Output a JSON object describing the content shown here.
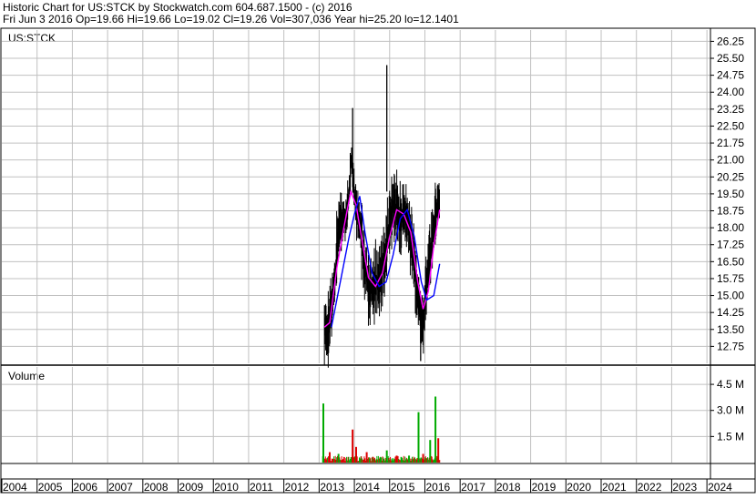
{
  "header": {
    "line1": "Historic Chart for US:STCK by Stockwatch.com 604.687.1500 - (c) 2016",
    "line2": "Fri Jun  3 2016   Op=19.66  Hi=19.66  Lo=19.02  Cl=19.26  Vol=307,036  Year hi=25.20  lo=12.1401"
  },
  "colors": {
    "price_bar": "#000000",
    "ma_short": "#ff00ff",
    "ma_long": "#0000ff",
    "volume_up": "#00aa00",
    "volume_down": "#dd0000",
    "grid": "#c0c0c0"
  },
  "chart_data": [
    {
      "type": "line",
      "title": "US:STCK",
      "ylim": [
        12.0,
        26.75
      ],
      "y_ticks": [
        "26.25",
        "25.50",
        "24.75",
        "24.00",
        "23.25",
        "22.50",
        "21.75",
        "21.00",
        "20.25",
        "19.50",
        "18.75",
        "18.00",
        "17.25",
        "16.50",
        "15.75",
        "15.00",
        "14.25",
        "13.50",
        "12.75"
      ],
      "x_ticks": [
        "2004",
        "2005",
        "2006",
        "2007",
        "2008",
        "2009",
        "2010",
        "2011",
        "2012",
        "2013",
        "2014",
        "2015",
        "2016",
        "2017",
        "2018",
        "2019",
        "2020",
        "2021",
        "2022",
        "2023",
        "2024"
      ],
      "grid": true,
      "series": [
        {
          "kind": "price",
          "points": [
            [
              2013.15,
              13.8
            ],
            [
              2013.25,
              13.2
            ],
            [
              2013.35,
              14.6
            ],
            [
              2013.45,
              15.8
            ],
            [
              2013.55,
              17.8
            ],
            [
              2013.65,
              18.4
            ],
            [
              2013.75,
              18.2
            ],
            [
              2013.85,
              19.6
            ],
            [
              2013.92,
              21.2
            ],
            [
              2014.0,
              19.4
            ],
            [
              2014.1,
              18.6
            ],
            [
              2014.2,
              17.6
            ],
            [
              2014.3,
              16.2
            ],
            [
              2014.4,
              15.4
            ],
            [
              2014.5,
              15.2
            ],
            [
              2014.6,
              15.6
            ],
            [
              2014.7,
              15.6
            ],
            [
              2014.8,
              16.2
            ],
            [
              2014.9,
              17.0
            ],
            [
              2015.0,
              18.4
            ],
            [
              2015.1,
              19.0
            ],
            [
              2015.2,
              18.8
            ],
            [
              2015.3,
              18.2
            ],
            [
              2015.4,
              18.8
            ],
            [
              2015.5,
              18.4
            ],
            [
              2015.6,
              17.6
            ],
            [
              2015.7,
              16.4
            ],
            [
              2015.8,
              15.0
            ],
            [
              2015.9,
              14.0
            ],
            [
              2015.95,
              13.6
            ],
            [
              2016.0,
              14.8
            ],
            [
              2016.1,
              16.2
            ],
            [
              2016.2,
              17.4
            ],
            [
              2016.3,
              18.6
            ],
            [
              2016.42,
              19.3
            ]
          ]
        },
        {
          "kind": "ma_short",
          "points": [
            [
              2013.15,
              13.6
            ],
            [
              2013.3,
              13.8
            ],
            [
              2013.5,
              16.2
            ],
            [
              2013.7,
              18.0
            ],
            [
              2013.9,
              19.6
            ],
            [
              2014.05,
              19.0
            ],
            [
              2014.2,
              17.6
            ],
            [
              2014.4,
              15.8
            ],
            [
              2014.6,
              15.4
            ],
            [
              2014.8,
              16.0
            ],
            [
              2015.0,
              17.6
            ],
            [
              2015.2,
              18.8
            ],
            [
              2015.4,
              18.6
            ],
            [
              2015.6,
              17.8
            ],
            [
              2015.8,
              15.6
            ],
            [
              2015.95,
              14.4
            ],
            [
              2016.1,
              15.2
            ],
            [
              2016.25,
              17.2
            ],
            [
              2016.42,
              18.8
            ]
          ]
        },
        {
          "kind": "ma_long",
          "points": [
            [
              2013.35,
              13.6
            ],
            [
              2013.6,
              15.6
            ],
            [
              2013.85,
              17.6
            ],
            [
              2014.0,
              18.6
            ],
            [
              2014.15,
              19.4
            ],
            [
              2014.3,
              17.8
            ],
            [
              2014.5,
              16.0
            ],
            [
              2014.7,
              15.4
            ],
            [
              2014.9,
              15.6
            ],
            [
              2015.1,
              16.8
            ],
            [
              2015.3,
              18.4
            ],
            [
              2015.5,
              18.8
            ],
            [
              2015.7,
              17.6
            ],
            [
              2015.9,
              15.6
            ],
            [
              2016.05,
              14.8
            ],
            [
              2016.25,
              15.0
            ],
            [
              2016.42,
              16.4
            ]
          ]
        }
      ],
      "spikes": [
        {
          "x": 2013.95,
          "hi": 23.3,
          "lo": 19.8
        },
        {
          "x": 2014.92,
          "hi": 25.2,
          "lo": 19.6
        },
        {
          "x": 2015.88,
          "hi": 14.8,
          "lo": 12.1
        },
        {
          "x": 2013.22,
          "hi": 13.6,
          "lo": 12.4
        }
      ]
    },
    {
      "type": "bar",
      "title": "Volume",
      "ylim": [
        0,
        5.5
      ],
      "y_ticks": [
        "4.5 M",
        "3.0 M",
        "1.5 M"
      ],
      "bars": [
        {
          "x": 2013.12,
          "v": 3.4,
          "up": true
        },
        {
          "x": 2013.3,
          "v": 0.6,
          "up": false
        },
        {
          "x": 2013.55,
          "v": 0.5,
          "up": true
        },
        {
          "x": 2013.95,
          "v": 1.9,
          "up": false
        },
        {
          "x": 2014.05,
          "v": 0.9,
          "up": false
        },
        {
          "x": 2014.35,
          "v": 0.6,
          "up": false
        },
        {
          "x": 2014.75,
          "v": 0.3,
          "up": true
        },
        {
          "x": 2014.92,
          "v": 0.7,
          "up": true
        },
        {
          "x": 2015.2,
          "v": 0.4,
          "up": false
        },
        {
          "x": 2015.55,
          "v": 0.4,
          "up": true
        },
        {
          "x": 2015.82,
          "v": 2.9,
          "up": true
        },
        {
          "x": 2015.95,
          "v": 0.5,
          "up": false
        },
        {
          "x": 2016.15,
          "v": 1.3,
          "up": true
        },
        {
          "x": 2016.3,
          "v": 3.8,
          "up": true
        },
        {
          "x": 2016.38,
          "v": 1.4,
          "up": false
        }
      ]
    }
  ]
}
